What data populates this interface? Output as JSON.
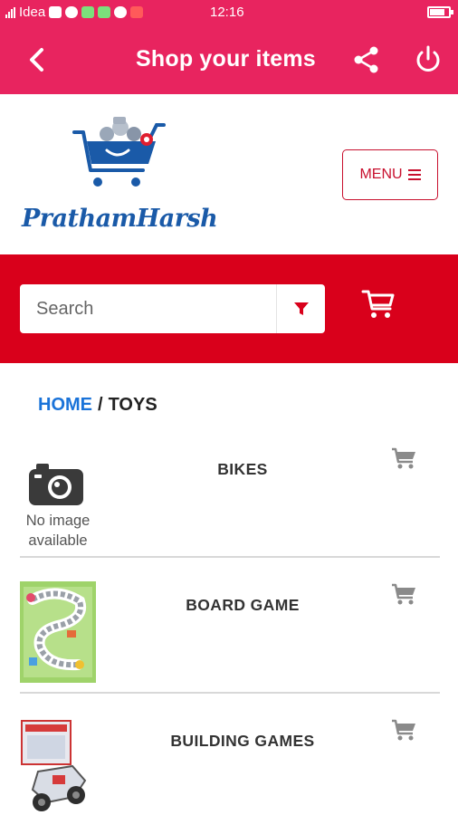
{
  "status_bar": {
    "carrier": "Idea",
    "time": "12:16"
  },
  "app_bar": {
    "title": "Shop your items",
    "back_icon": "chevron-left-icon",
    "share_icon": "share-icon",
    "power_icon": "power-icon"
  },
  "logo": {
    "text": "PrathamHarsh"
  },
  "menu_button": {
    "label": "MENU"
  },
  "search": {
    "placeholder": "Search",
    "filter_icon": "filter-icon",
    "cart_icon": "shopping-cart-icon"
  },
  "breadcrumb": {
    "home": "HOME",
    "separator": "/",
    "current": "TOYS"
  },
  "categories": [
    {
      "name": "BIKES",
      "image": "no-image",
      "no_image_text": "No image available"
    },
    {
      "name": "BOARD GAME",
      "image": "board-game-image"
    },
    {
      "name": "BUILDING GAMES",
      "image": "building-games-image"
    }
  ],
  "colors": {
    "primary": "#e8245f",
    "search_band": "#d9001b",
    "link": "#1a73d9",
    "logo_blue": "#1a5aa8"
  }
}
